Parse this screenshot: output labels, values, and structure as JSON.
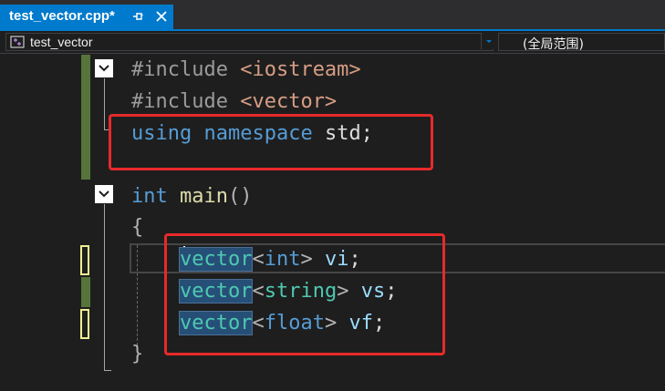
{
  "tab": {
    "title": "test_vector.cpp*",
    "pin_icon": "pin-icon",
    "close_icon": "close-icon"
  },
  "navbar": {
    "scope_icon": "project-icon",
    "scope": "test_vector",
    "member": "(全局范围)"
  },
  "code": {
    "lines": [
      {
        "tokens": [
          {
            "t": "#include ",
            "c": "pp"
          },
          {
            "t": "<iostream>",
            "c": "inc"
          }
        ]
      },
      {
        "tokens": [
          {
            "t": "#include ",
            "c": "pp"
          },
          {
            "t": "<vector>",
            "c": "inc"
          }
        ]
      },
      {
        "tokens": [
          {
            "t": "using",
            "c": "kw"
          },
          {
            "t": " ",
            "c": ""
          },
          {
            "t": "namespace",
            "c": "kw"
          },
          {
            "t": " std;",
            "c": ""
          }
        ]
      },
      {
        "tokens": []
      },
      {
        "tokens": [
          {
            "t": "int",
            "c": "kw"
          },
          {
            "t": " ",
            "c": ""
          },
          {
            "t": "main",
            "c": "fn"
          },
          {
            "t": "()",
            "c": "pun"
          }
        ]
      },
      {
        "tokens": [
          {
            "t": "{",
            "c": "pun"
          }
        ]
      },
      {
        "tokens": [
          {
            "t": "    ",
            "c": ""
          },
          {
            "t": "vector",
            "c": "hl"
          },
          {
            "t": "<",
            "c": "pun"
          },
          {
            "t": "int",
            "c": "kw"
          },
          {
            "t": ">",
            "c": "pun"
          },
          {
            "t": " ",
            "c": ""
          },
          {
            "t": "vi",
            "c": "var"
          },
          {
            "t": ";",
            "c": ""
          }
        ]
      },
      {
        "tokens": [
          {
            "t": "    ",
            "c": ""
          },
          {
            "t": "vector",
            "c": "hl"
          },
          {
            "t": "<",
            "c": "pun"
          },
          {
            "t": "string",
            "c": "ty"
          },
          {
            "t": ">",
            "c": "pun"
          },
          {
            "t": " ",
            "c": ""
          },
          {
            "t": "vs",
            "c": "var"
          },
          {
            "t": ";",
            "c": ""
          }
        ]
      },
      {
        "tokens": [
          {
            "t": "    ",
            "c": ""
          },
          {
            "t": "vector",
            "c": "hl"
          },
          {
            "t": "<",
            "c": "pun"
          },
          {
            "t": "float",
            "c": "kw"
          },
          {
            "t": ">",
            "c": "pun"
          },
          {
            "t": " ",
            "c": ""
          },
          {
            "t": "vf",
            "c": "var"
          },
          {
            "t": ";",
            "c": ""
          }
        ]
      },
      {
        "tokens": [
          {
            "t": "}",
            "c": "pun"
          }
        ]
      }
    ]
  },
  "colors": {
    "accent": "#007acc",
    "saved_change": "#57743b",
    "unsaved_change": "#efef91",
    "annotation": "#e62a2a"
  }
}
